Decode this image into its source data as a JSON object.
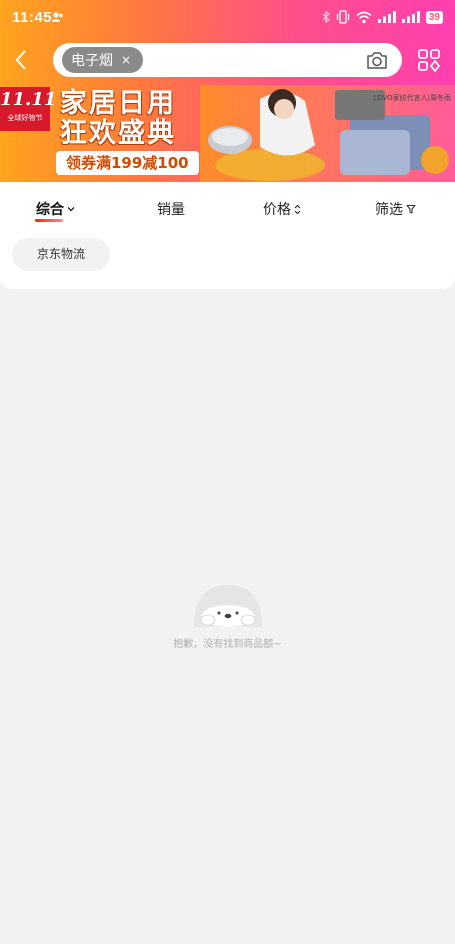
{
  "status_bar": {
    "time": "11:45",
    "battery": "39"
  },
  "search": {
    "keyword_chip": "电子烟",
    "chip_close": "×"
  },
  "banner": {
    "logo_main": "11.11",
    "logo_sub": "全球好物节",
    "title_line1": "家居日用",
    "title_line2": "狂欢盛典",
    "coupon": "领券满199减100",
    "brand_note": "LOVO家纺代言人|周冬雨"
  },
  "sort_tabs": [
    {
      "label": "综合",
      "icon": "chevron-down-icon"
    },
    {
      "label": "销量"
    },
    {
      "label": "价格",
      "icon": "sort-arrows-icon"
    },
    {
      "label": "筛选",
      "icon": "filter-icon"
    }
  ],
  "filter_tags": [
    "京东物流"
  ],
  "empty_state": {
    "message": "抱歉，没有找到商品额~"
  },
  "colors": {
    "accent_red": "#f2270c",
    "header_orange": "#ffa41e",
    "header_pink": "#ff3fb0"
  }
}
